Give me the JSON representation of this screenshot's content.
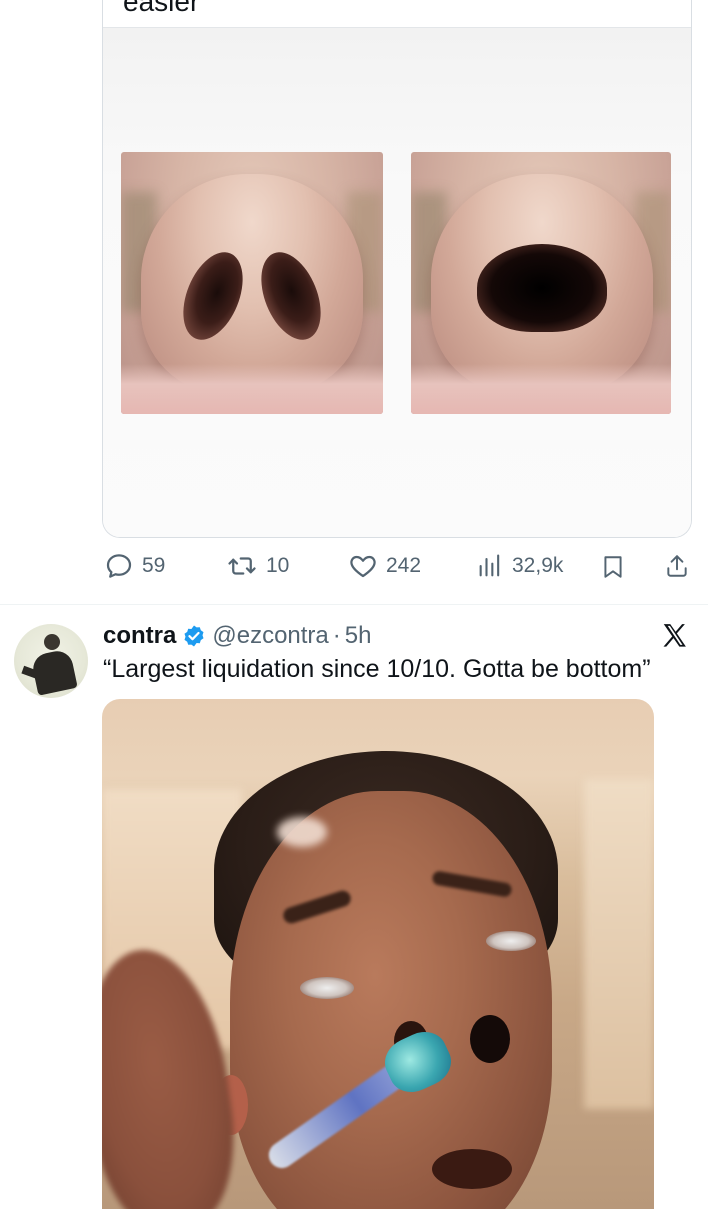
{
  "quoted_tweet": {
    "text": "easier",
    "images": [
      "nose-before",
      "nose-after"
    ]
  },
  "actions": {
    "replies": "59",
    "retweets": "10",
    "likes": "242",
    "views": "32,9k"
  },
  "tweet": {
    "name": "contra",
    "handle": "@ezcontra",
    "separator": "·",
    "time": "5h",
    "text": "“Largest liquidation since 10/10. Gotta be bottom”",
    "platform_icon": "x-logo-icon",
    "verified_color": "#1d9bf0"
  },
  "colors": {
    "text": "#0f1419",
    "secondary": "#536471",
    "border": "#d9dee3",
    "verified": "#1d9bf0"
  }
}
